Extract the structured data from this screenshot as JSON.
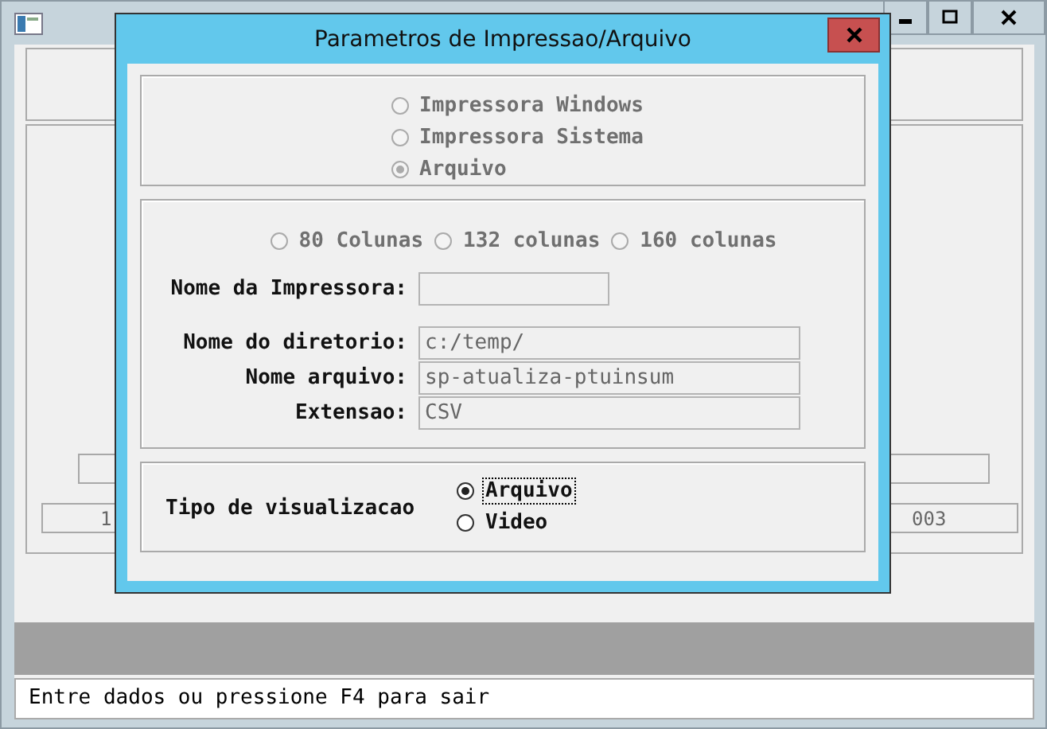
{
  "background_window": {
    "fields": [
      {
        "value": "1"
      },
      {
        "value": "003"
      }
    ]
  },
  "status_bar": {
    "text": "Entre dados ou pressione F4 para sair"
  },
  "dialog": {
    "title": "Parametros de Impressao/Arquivo",
    "output_options": [
      {
        "label": "Impressora Windows",
        "selected": false,
        "disabled": true
      },
      {
        "label": "Impressora Sistema",
        "selected": false,
        "disabled": true
      },
      {
        "label": "Arquivo",
        "selected": true,
        "disabled": true
      }
    ],
    "column_options": [
      {
        "label": "80 Colunas",
        "selected": false,
        "disabled": true
      },
      {
        "label": "132 colunas",
        "selected": false,
        "disabled": true
      },
      {
        "label": "160 colunas",
        "selected": false,
        "disabled": true
      }
    ],
    "printer_name": {
      "label": "Nome da Impressora:"
    },
    "file_fields": [
      {
        "label": "Nome do diretorio:",
        "value": "c:/temp/"
      },
      {
        "label": "Nome arquivo:",
        "value": "sp-atualiza-ptuinsum"
      },
      {
        "label": "Extensao:",
        "value": "CSV"
      }
    ],
    "view_type": {
      "label": "Tipo de visualizacao",
      "options": [
        {
          "label": "Arquivo",
          "selected": true,
          "focused": true
        },
        {
          "label": "Video",
          "selected": false,
          "focused": false
        }
      ]
    }
  }
}
